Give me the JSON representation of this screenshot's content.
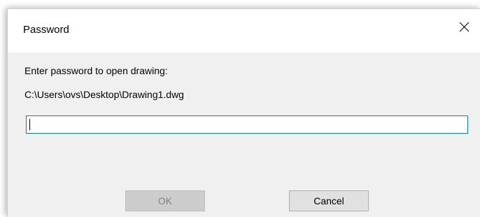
{
  "dialog": {
    "title": "Password",
    "close_icon": "close-icon",
    "prompt": "Enter password to open drawing:",
    "file_path": "C:\\Users\\ovs\\Desktop\\Drawing1.dwg",
    "password_value": "",
    "ok_label": "OK",
    "cancel_label": "Cancel",
    "ok_enabled": false
  },
  "colors": {
    "titlebar_bg": "#ffffff",
    "body_bg": "#f0f0f0",
    "input_focus_border": "#0078d7",
    "disabled_button_bg": "#cccccc",
    "button_bg": "#e1e1e1"
  }
}
